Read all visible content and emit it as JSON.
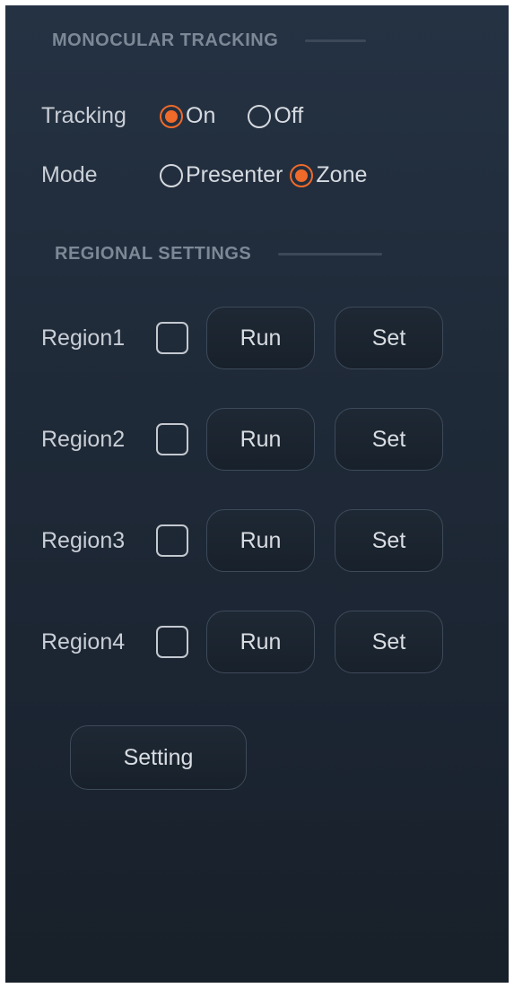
{
  "monocular": {
    "heading": "MONOCULAR TRACKING"
  },
  "tracking": {
    "label": "Tracking",
    "options": [
      {
        "label": "On",
        "selected": true
      },
      {
        "label": "Off",
        "selected": false
      }
    ]
  },
  "mode": {
    "label": "Mode",
    "options": [
      {
        "label": "Presenter",
        "selected": false
      },
      {
        "label": "Zone",
        "selected": true
      }
    ]
  },
  "regional": {
    "heading": "REGIONAL SETTINGS",
    "regions": [
      {
        "label": "Region1",
        "checked": false,
        "run_label": "Run",
        "set_label": "Set"
      },
      {
        "label": "Region2",
        "checked": false,
        "run_label": "Run",
        "set_label": "Set"
      },
      {
        "label": "Region3",
        "checked": false,
        "run_label": "Run",
        "set_label": "Set"
      },
      {
        "label": "Region4",
        "checked": false,
        "run_label": "Run",
        "set_label": "Set"
      }
    ]
  },
  "setting_button": {
    "label": "Setting"
  },
  "colors": {
    "accent": "#f06a2a",
    "panel_bg": "#212c3a",
    "text": "#c9ced6",
    "heading": "#7d8896"
  }
}
